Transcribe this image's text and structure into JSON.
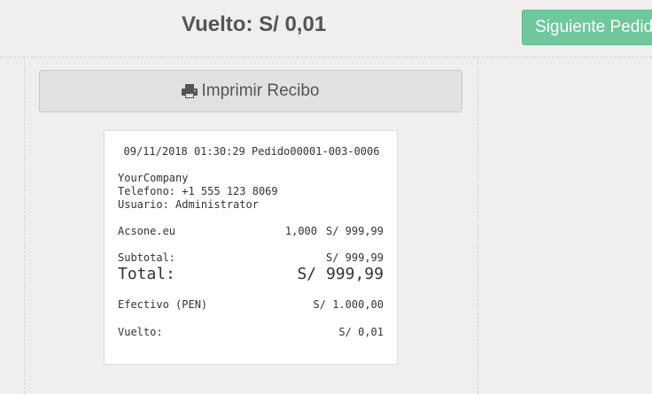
{
  "header": {
    "change_title": "Vuelto: S/ 0,01",
    "next_order_label": "Siguiente Pedido"
  },
  "print_button": {
    "label": "Imprimir Recibo",
    "icon": "print-icon"
  },
  "receipt": {
    "header_line": "09/11/2018 01:30:29 Pedido00001-003-0006",
    "company": "YourCompany",
    "phone": "Telefono: +1 555 123 8069",
    "user": "Usuario: Administrator",
    "line_items": [
      {
        "product": "Acsone.eu",
        "qty": "1,000",
        "price": "S/ 999,99"
      }
    ],
    "subtotal_label": "Subtotal:",
    "subtotal_value": "S/ 999,99",
    "total_label": "Total:",
    "total_value": "S/ 999,99",
    "payment_label": "Efectivo (PEN)",
    "payment_value": "S/ 1.000,00",
    "change_label": "Vuelto:",
    "change_value": "S/ 0,01"
  },
  "colors": {
    "background": "#f0eeee",
    "next_button": "#6ec89b",
    "text": "#555555"
  }
}
